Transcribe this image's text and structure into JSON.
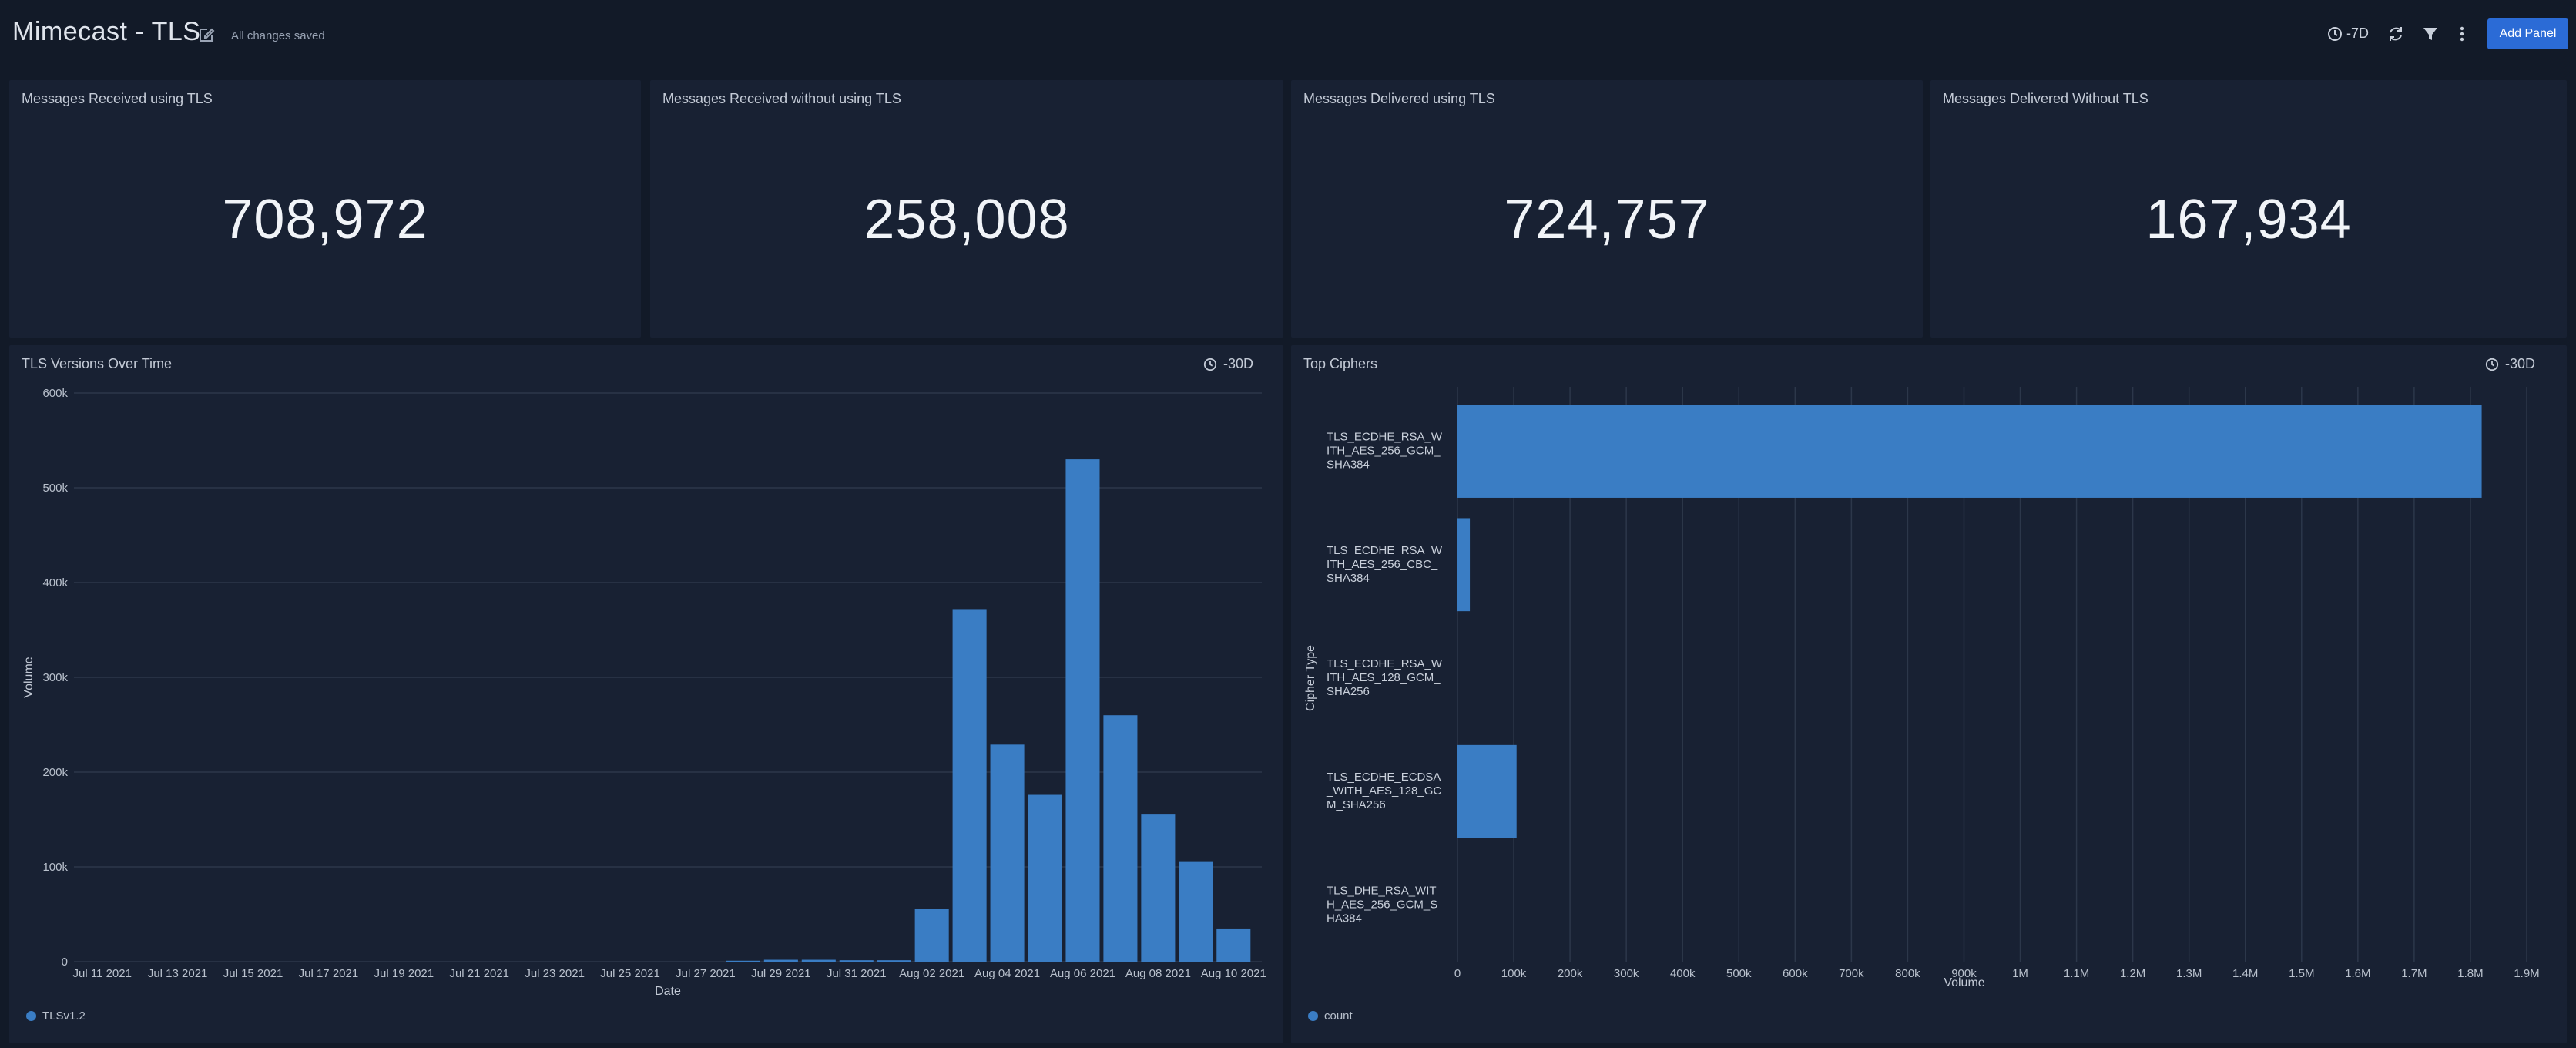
{
  "header": {
    "title": "Mimecast - TLS",
    "save_status": "All changes saved",
    "time_range": "-7D",
    "add_panel_label": "Add Panel"
  },
  "stats": [
    {
      "title": "Messages Received using TLS",
      "value": "708,972"
    },
    {
      "title": "Messages Received without using TLS",
      "value": "258,008"
    },
    {
      "title": "Messages Delivered using TLS",
      "value": "724,757"
    },
    {
      "title": "Messages Delivered Without TLS",
      "value": "167,934"
    }
  ],
  "tls_panel": {
    "title": "TLS Versions Over Time",
    "time_range": "-30D",
    "legend_label": "TLSv1.2"
  },
  "cipher_panel": {
    "title": "Top Ciphers",
    "time_range": "-30D",
    "legend_label": "count"
  },
  "colors": {
    "background": "#121a28",
    "panel": "#182133",
    "bar": "#3a7dc4",
    "accent_button": "#2b6bd6"
  },
  "chart_data": [
    {
      "type": "bar",
      "title": "TLS Versions Over Time",
      "xlabel": "Date",
      "ylabel": "Volume",
      "ylim": [
        0,
        600000
      ],
      "y_ticks": [
        "0",
        "100k",
        "200k",
        "300k",
        "400k",
        "500k",
        "600k"
      ],
      "y_tick_values": [
        0,
        100000,
        200000,
        300000,
        400000,
        500000,
        600000
      ],
      "x_tick_labels": [
        "Jul 11 2021",
        "Jul 13 2021",
        "Jul 15 2021",
        "Jul 17 2021",
        "Jul 19 2021",
        "Jul 21 2021",
        "Jul 23 2021",
        "Jul 25 2021",
        "Jul 27 2021",
        "Jul 29 2021",
        "Jul 31 2021",
        "Aug 02 2021",
        "Aug 04 2021",
        "Aug 06 2021",
        "Aug 08 2021",
        "Aug 10 2021"
      ],
      "categories": [
        "Jul 11 2021",
        "Jul 12 2021",
        "Jul 13 2021",
        "Jul 14 2021",
        "Jul 15 2021",
        "Jul 16 2021",
        "Jul 17 2021",
        "Jul 18 2021",
        "Jul 19 2021",
        "Jul 20 2021",
        "Jul 21 2021",
        "Jul 22 2021",
        "Jul 23 2021",
        "Jul 24 2021",
        "Jul 25 2021",
        "Jul 26 2021",
        "Jul 27 2021",
        "Jul 28 2021",
        "Jul 29 2021",
        "Jul 30 2021",
        "Jul 31 2021",
        "Aug 01 2021",
        "Aug 02 2021",
        "Aug 03 2021",
        "Aug 04 2021",
        "Aug 05 2021",
        "Aug 06 2021",
        "Aug 07 2021",
        "Aug 08 2021",
        "Aug 09 2021",
        "Aug 10 2021"
      ],
      "series": [
        {
          "name": "TLSv1.2",
          "values": [
            0,
            0,
            0,
            0,
            0,
            0,
            0,
            0,
            0,
            0,
            0,
            0,
            0,
            0,
            0,
            0,
            0,
            1000,
            2000,
            2000,
            1500,
            1500,
            56000,
            372000,
            229000,
            176000,
            530000,
            260000,
            156000,
            106000,
            35000
          ]
        }
      ],
      "legend": "bottom-left",
      "grid": true
    },
    {
      "type": "bar",
      "orientation": "horizontal",
      "title": "Top Ciphers",
      "xlabel": "Volume",
      "ylabel": "Cipher Type",
      "xlim": [
        0,
        1900000
      ],
      "x_ticks": [
        "0",
        "100k",
        "200k",
        "300k",
        "400k",
        "500k",
        "600k",
        "700k",
        "800k",
        "900k",
        "1M",
        "1.1M",
        "1.2M",
        "1.3M",
        "1.4M",
        "1.5M",
        "1.6M",
        "1.7M",
        "1.8M",
        "1.9M"
      ],
      "x_tick_values": [
        0,
        100000,
        200000,
        300000,
        400000,
        500000,
        600000,
        700000,
        800000,
        900000,
        1000000,
        1100000,
        1200000,
        1300000,
        1400000,
        1500000,
        1600000,
        1700000,
        1800000,
        1900000
      ],
      "categories": [
        [
          "TLS_ECDHE_RSA_W",
          "ITH_AES_256_GCM_",
          "SHA384"
        ],
        [
          "TLS_ECDHE_RSA_W",
          "ITH_AES_256_CBC_",
          "SHA384"
        ],
        [
          "TLS_ECDHE_RSA_W",
          "ITH_AES_128_GCM_",
          "SHA256"
        ],
        [
          "TLS_ECDHE_ECDSA",
          "_WITH_AES_128_GC",
          "M_SHA256"
        ],
        [
          "TLS_DHE_RSA_WIT",
          "H_AES_256_GCM_S",
          "HA384"
        ]
      ],
      "series": [
        {
          "name": "count",
          "values": [
            1820000,
            22000,
            0,
            105000,
            0
          ]
        }
      ],
      "legend": "bottom-left",
      "grid": true
    }
  ]
}
